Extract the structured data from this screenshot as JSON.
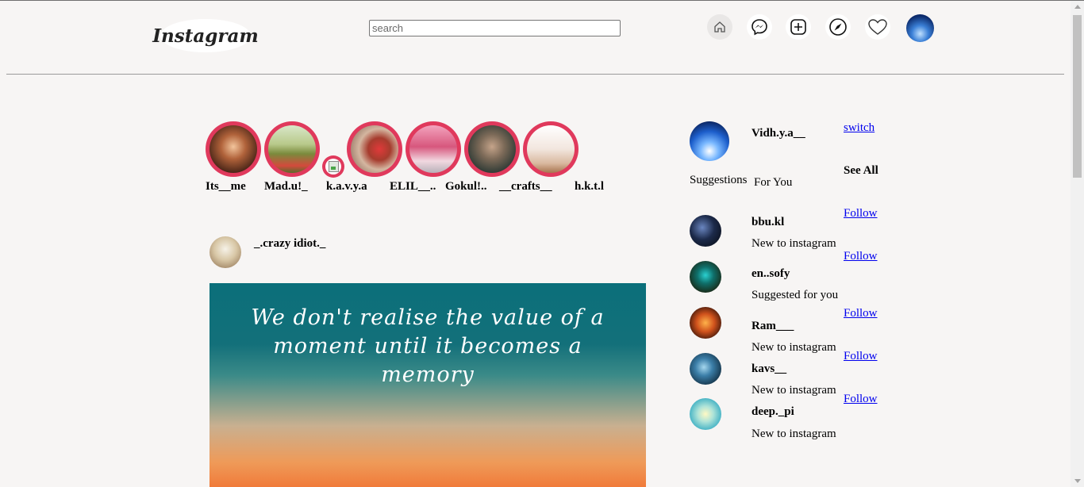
{
  "header": {
    "logo_text": "Instagram",
    "search_placeholder": "search",
    "nav_icons": [
      "home-icon",
      "messenger-icon",
      "add-post-icon",
      "explore-icon",
      "heart-icon"
    ]
  },
  "stories": [
    {
      "label": "Its__me"
    },
    {
      "label": "Mad.u!_"
    },
    {
      "label": "k.a.v.y.a"
    },
    {
      "label": "ELIL__.."
    },
    {
      "label": "Gokul!.."
    },
    {
      "label": "__crafts__"
    },
    {
      "label": "h.k.t.l"
    }
  ],
  "post": {
    "username": "_.crazy idiot._",
    "quote": "We don't realise the value of a moment until it becomes a memory"
  },
  "sidebar": {
    "username": "Vidh.y.a__",
    "switch_label": "switch",
    "suggestions_label": "Suggestions",
    "for_you_label": "For You",
    "see_all_label": "See All",
    "suggestions": [
      {
        "name": "bbu.kl",
        "sub": "New to instagram",
        "follow": "Follow"
      },
      {
        "name": "en..sofy",
        "sub": "Suggested for you",
        "follow": "Follow"
      },
      {
        "name": "Ram___",
        "sub": "New to instagram",
        "follow": "Follow"
      },
      {
        "name": "kavs__",
        "sub": "New to instagram",
        "follow": "Follow"
      },
      {
        "name": "deep._pi",
        "sub": "New to instagram",
        "follow": "Follow"
      }
    ]
  },
  "colors": {
    "story_ring": "#e0395c",
    "link": "#0000ee",
    "background": "#f7f5f4"
  }
}
